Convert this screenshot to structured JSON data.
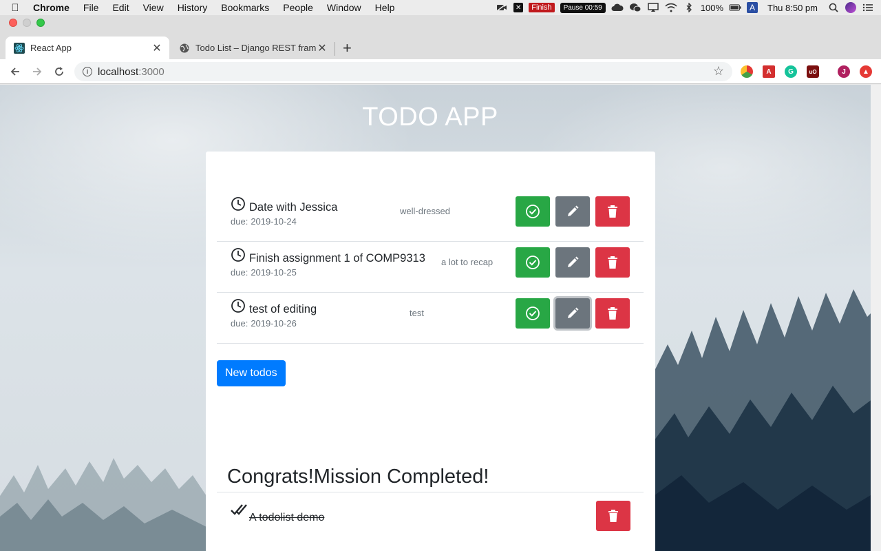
{
  "menubar": {
    "app_name": "Chrome",
    "items": [
      "File",
      "Edit",
      "View",
      "History",
      "Bookmarks",
      "People",
      "Window",
      "Help"
    ],
    "finish_label": "Finish",
    "pause_label": "Pause 00:59",
    "battery": "100%",
    "clock": "Thu 8:50 pm",
    "input_source": "A"
  },
  "browser": {
    "tabs": [
      {
        "title": "React App",
        "icon": "react-icon",
        "active": true
      },
      {
        "title": "Todo List – Django REST framework",
        "icon": "globe-icon",
        "active": false
      }
    ],
    "url_host": "localhost",
    "url_port": ":3000",
    "extensions": [
      "color-picker-icon",
      "acrobat-icon",
      "grammarly-icon",
      "ublock-icon",
      "profile-avatar",
      "extension-up-icon"
    ],
    "profile_initial": "J"
  },
  "app": {
    "title": "TODO APP",
    "todos": [
      {
        "title": "Date with Jessica",
        "due_label": "due:",
        "due_date": "2019-10-24",
        "description": "well-dressed"
      },
      {
        "title": "Finish assignment 1 of COMP9313",
        "due_label": "due:",
        "due_date": "2019-10-25",
        "description": "a lot to recap"
      },
      {
        "title": "test of editing",
        "due_label": "due:",
        "due_date": "2019-10-26",
        "description": "test"
      }
    ],
    "new_button": "New todos",
    "completed_heading": "Congrats!Mission Completed!",
    "completed": [
      {
        "title": "A todolist demo"
      }
    ],
    "colors": {
      "done": "#28a745",
      "edit": "#6c757d",
      "delete": "#dc3545",
      "primary": "#007bff"
    }
  }
}
